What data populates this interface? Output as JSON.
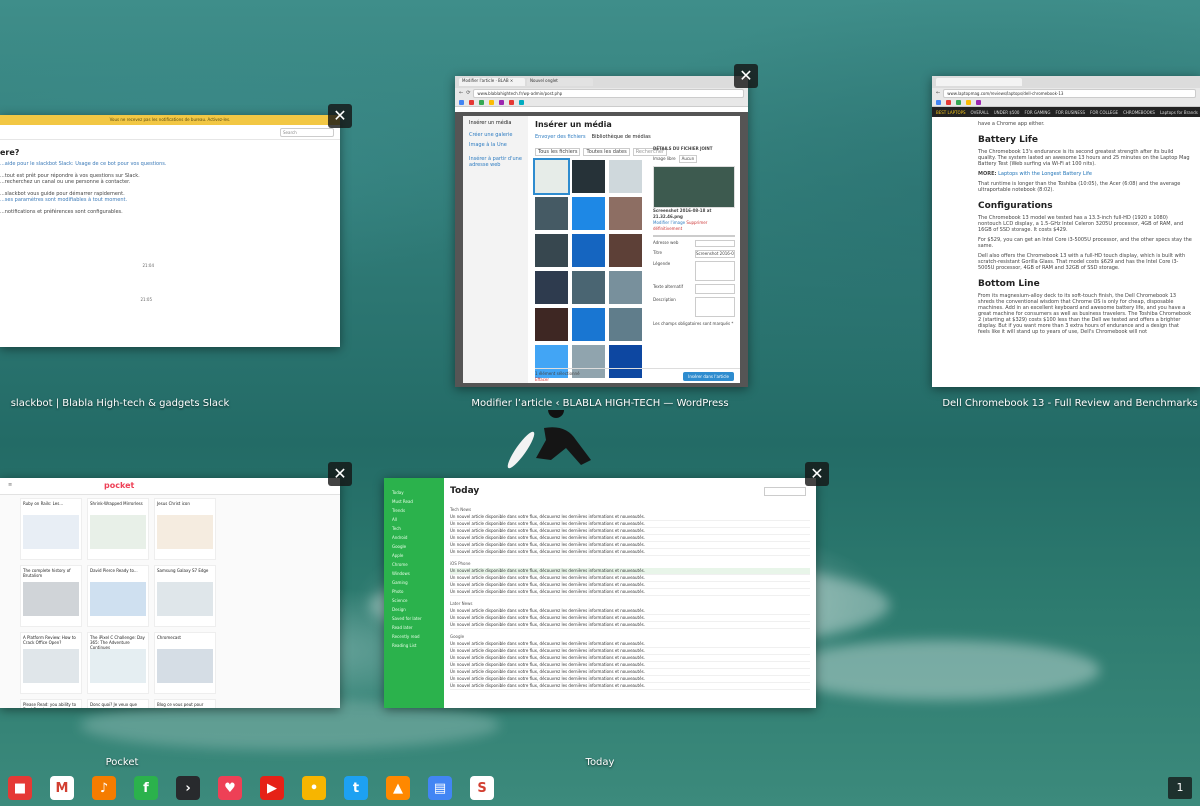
{
  "windows": {
    "slack": {
      "label": "slackbot | Blabla High-tech & gadgets Slack",
      "banner": "Vous ne recevez pas les notifications de bureau. Activez-les.",
      "search": "Search",
      "heading": "ere?",
      "lines": [
        "...aide pour le slackbot Slack: Usage de ce bot pour vos questions.",
        "...tout est prêt pour répondre à vos questions sur Slack.",
        "...recherchez un canal ou une personne à contacter.",
        "...slackbot vous guide pour démarrer rapidement.",
        "...ses paramètres sont modifiables à tout moment.",
        "...notifications et préférences sont configurables."
      ],
      "time1": "21:04",
      "time2": "21:05"
    },
    "wordpress": {
      "label": "Modifier l’article ‹ BLABLA HIGH-TECH — WordPress",
      "tab1": "Modifier l'article · BLAB ×",
      "tab2": "Nouvel onglet",
      "url": "www.blablahightech.fr/wp-admin/post.php",
      "modal_title": "Insérer un média",
      "menu": [
        "Insérer un média",
        "Créer une galerie",
        "Image à la Une",
        "Insérer à partir d'une adresse web"
      ],
      "tab_upload": "Envoyer des fichiers",
      "tab_library": "Bibliothèque de médias",
      "filter1": "Tous les fichiers",
      "filter2": "Toutes les dates",
      "search_placeholder": "Rechercher",
      "details_title": "DÉTAILS DU FICHIER JOINT",
      "image_name": "Screenshot 2016-08-18 at 21.32.46.png",
      "fields": [
        "Image libre",
        "Adresse web",
        "Titre",
        "Légende",
        "Texte alternatif",
        "Description"
      ],
      "field_value": "Aucun",
      "title_value": "Screenshot 2016-08-18 at 21.32.46",
      "edit_link": "Modifier l'image",
      "delete_link": "Supprimer définitivement",
      "selected": "1 élément sélectionné",
      "clear": "Effacer",
      "insert_button": "Insérer dans l'article",
      "note": "Les champs obligatoires sont marqués *"
    },
    "laptop": {
      "label": "Dell Chromebook 13 - Full Review and Benchmarks",
      "url": "www.laptopmag.com/reviews/laptops/dell-chromebook-13",
      "nav": [
        "BEST LAPTOPS",
        "OVERALL",
        "UNDER $500",
        "FOR GAMING",
        "FOR BUSINESS",
        "FOR COLLEGE",
        "CHROMEBOOKS",
        "Laptops for Brands"
      ],
      "intro": "have a Chrome app either.",
      "h_battery": "Battery Life",
      "p_battery": "The Chromebook 13's endurance is its second greatest strength after its build quality. The system lasted an awesome 13 hours and 25 minutes on the Laptop Mag Battery Test (Web surfing via Wi-Fi at 100 nits).",
      "note_label": "MORE:",
      "note_link": "Laptops with the Longest Battery Life",
      "p_battery2": "That runtime is longer than the Toshiba (10:05), the Acer (6:08) and the average ultraportable notebook (8:02).",
      "h_config": "Configurations",
      "p_config": "The Chromebook 13 model we tested has a 13.3-inch full-HD (1920 x 1080) nontouch LCD display, a 1.5-GHz Intel Celeron 3205U processor, 4GB of RAM, and 16GB of SSD storage. It costs $429.",
      "p_config2": "For $529, you can get an Intel Core i3-5005U processor, and the other specs stay the same.",
      "p_config3": "Dell also offers the Chromebook 13 with a full-HD touch display, which is built with scratch-resistant Gorilla Glass. That model costs $629 and has the Intel Core i3-5005U processor, 4GB of RAM and 32GB of SSD storage.",
      "h_bottom": "Bottom Line",
      "p_bottom": "From its magnesium-alloy deck to its soft-touch finish, the Dell Chromebook 13 shreds the conventional wisdom that Chrome OS is only for cheap, disposable machines. Add in an excellent keyboard and awesome battery life, and you have a great machine for consumers as well as business travelers. The Toshiba Chromebook 2 (starting at $329) costs $100 less than the Dell we tested and offers a brighter display. But if you want more than 3 extra hours of endurance and a design that feels like it will stand up to years of use, Dell's Chromebook will not"
    },
    "pocket": {
      "label": "Pocket",
      "brand": "pocket",
      "cards": [
        {
          "title": "Ruby on Rails: Les...",
          "color": "#e8eef5"
        },
        {
          "title": "Shrink-Wrapped Mirrorless",
          "color": "#e8f0e8"
        },
        {
          "title": "Jesus Christ icon",
          "color": "#f5ece0"
        },
        {
          "title": "The complete history of Brutalism",
          "color": "#d0d4d8"
        },
        {
          "title": "David Pierce Ready to...",
          "color": "#cfe0f0"
        },
        {
          "title": "Samsung Galaxy S7 Edge",
          "color": "#dfe6ea"
        },
        {
          "title": "A Platform Review: How to Crack Office Open?",
          "color": "#e0e6ea"
        },
        {
          "title": "The iPixel C Challenge: Day 365: The Adventure Continues",
          "color": "#e5eef2"
        },
        {
          "title": "Chromecast",
          "color": "#d5dde5"
        },
        {
          "title": "Please Read: you ability to Dual-Band",
          "color": "#e8e8e8"
        },
        {
          "title": "Donc quoi? Je veux que",
          "color": "#e8e8e8"
        },
        {
          "title": "Blog ce vous peut pour",
          "color": "#e8e8e8"
        }
      ]
    },
    "today": {
      "label": "Today",
      "header": "Today",
      "sidebar_items": [
        "Today",
        "Must Read",
        "Trends",
        "All",
        "Tech",
        "Android",
        "Google",
        "Apple",
        "Chrome",
        "Windows",
        "Gaming",
        "Photo",
        "Science",
        "Design",
        "Saved for later",
        "Read later",
        "Recently read",
        "Reading List"
      ],
      "sections": [
        "Tech News",
        "iOS Phone",
        "Later News",
        "Google"
      ],
      "row_text": "Un nouvel article disponible dans votre flux, découvrez les dernières informations et nouveautés."
    }
  },
  "shelf": {
    "apps": [
      {
        "name": "photos",
        "color": "#e53935",
        "glyph": "■"
      },
      {
        "name": "gmail",
        "color": "#ffffff",
        "glyph": "M"
      },
      {
        "name": "play-music",
        "color": "#f57c00",
        "glyph": "♪"
      },
      {
        "name": "feedly",
        "color": "#2bb24c",
        "glyph": "f"
      },
      {
        "name": "plex",
        "color": "#282a2d",
        "glyph": "›"
      },
      {
        "name": "pocket",
        "color": "#ee4056",
        "glyph": "♥"
      },
      {
        "name": "youtube",
        "color": "#e62117",
        "glyph": "▶"
      },
      {
        "name": "keep",
        "color": "#f7b500",
        "glyph": "•"
      },
      {
        "name": "twitter",
        "color": "#1da1f2",
        "glyph": "t"
      },
      {
        "name": "vlc",
        "color": "#ff8800",
        "glyph": "▲"
      },
      {
        "name": "files",
        "color": "#4285f4",
        "glyph": "▤"
      },
      {
        "name": "slack",
        "color": "#ffffff",
        "glyph": "S"
      }
    ],
    "status": "1"
  },
  "close_glyph": "✕"
}
